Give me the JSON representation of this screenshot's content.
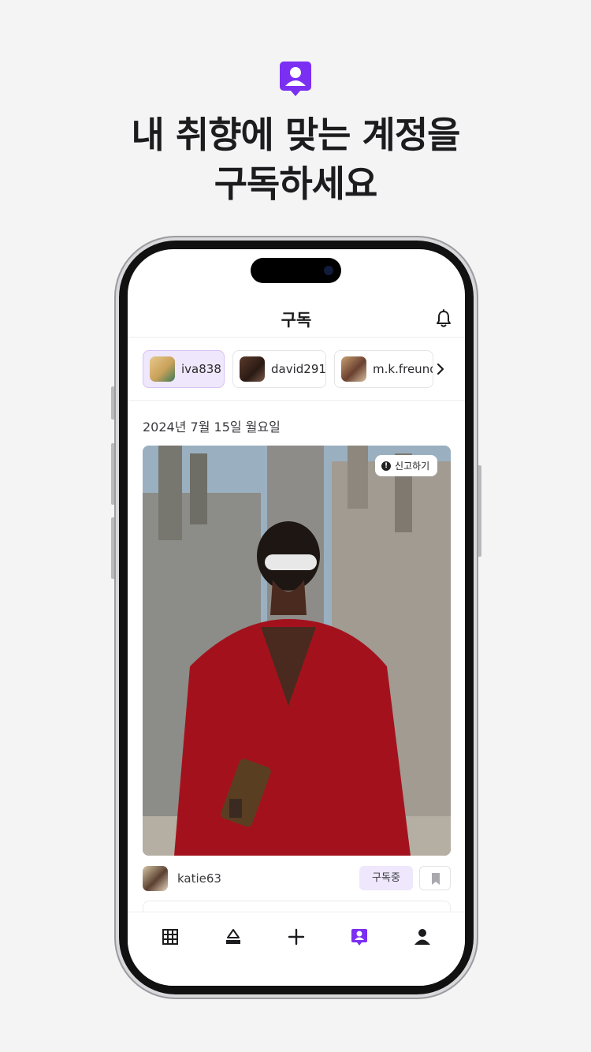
{
  "headline": {
    "line1": "내 취향에 맞는 계정을",
    "line2": "구독하세요",
    "icon": "subscription-person-icon"
  },
  "colors": {
    "accent": "#7b2ff2",
    "chip_active_bg": "#efe7fb",
    "background": "#f4f4f5"
  },
  "app": {
    "nav_title": "구독",
    "bell_icon": "bell-icon",
    "chips": [
      {
        "name": "iva838",
        "active": true
      },
      {
        "name": "david291",
        "active": false
      },
      {
        "name": "m.k.freund",
        "active": false
      }
    ],
    "date": "2024년 7월 15일 월요일",
    "post": {
      "report_label": "신고하기",
      "author": "katie63",
      "subscribe_label": "구독중"
    },
    "tabs": [
      {
        "icon": "grid-icon",
        "active": false
      },
      {
        "icon": "closet-icon",
        "active": false
      },
      {
        "icon": "plus-icon",
        "active": false
      },
      {
        "icon": "subscription-icon",
        "active": true
      },
      {
        "icon": "profile-icon",
        "active": false
      }
    ]
  }
}
